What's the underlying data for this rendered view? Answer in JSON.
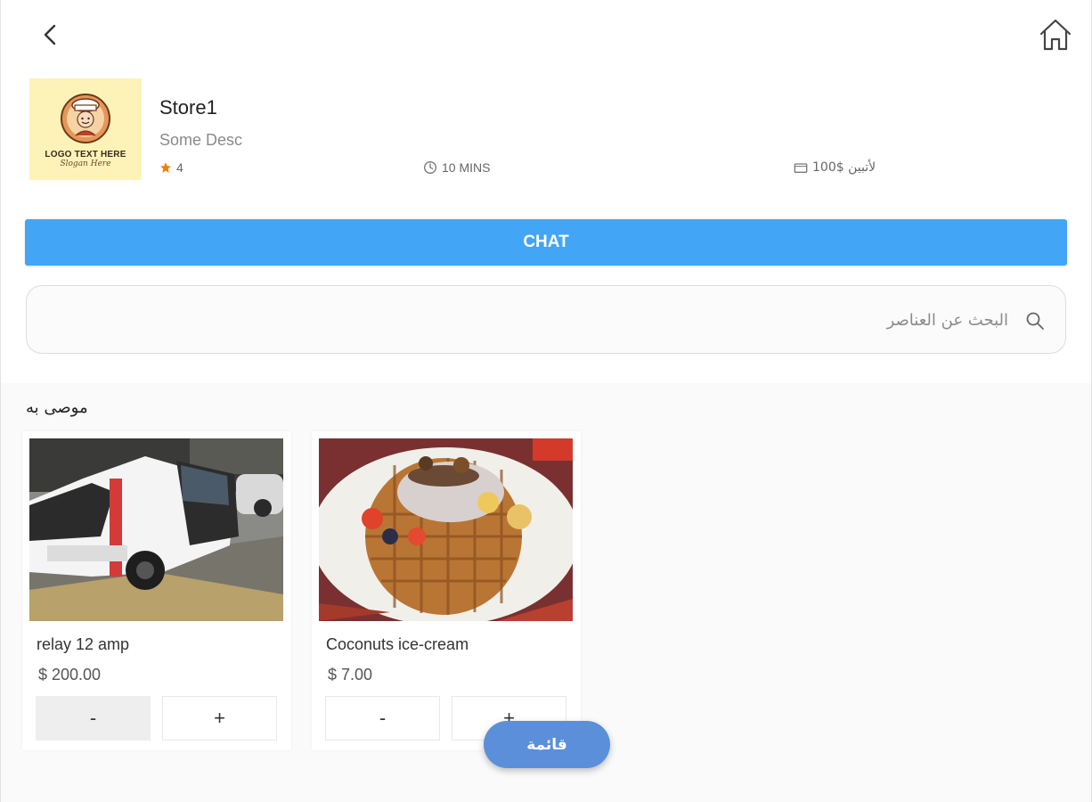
{
  "store": {
    "name": "Store1",
    "description": "Some Desc",
    "rating": "4",
    "delivery_time": "10 MINS",
    "delivery_fee": "لأتبين $100",
    "logo_text": "LOGO TEXT HERE",
    "logo_sub": "Slogan Here"
  },
  "chat_button": {
    "label": "CHAT"
  },
  "search": {
    "placeholder": "البحث عن العناصر"
  },
  "recommended": {
    "title": "موصى به",
    "items": [
      {
        "name": "relay 12 amp",
        "price": "$ 200.00",
        "minus_label": "-",
        "plus_label": "+",
        "minus_disabled": true
      },
      {
        "name": "Coconuts ice-cream",
        "price": "$ 7.00",
        "minus_label": "-",
        "plus_label": "+",
        "minus_disabled": false
      }
    ]
  },
  "menu_button": {
    "label": "قائمة"
  },
  "colors": {
    "chat_button": "#42a5f5",
    "menu_button": "#5b8fd9",
    "logo_background": "#fdf3b8",
    "rating_star": "#f57c00"
  },
  "icons": {
    "back": "chevron-left-icon",
    "home": "home-icon",
    "rating": "star-icon",
    "time": "clock-icon",
    "delivery": "wallet-icon",
    "search": "search-icon"
  }
}
